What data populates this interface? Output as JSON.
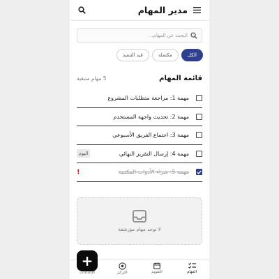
{
  "header": {
    "title": "مدير المهام",
    "menu_icon": "menu-icon",
    "search_icon": "search-icon"
  },
  "search": {
    "placeholder": "البحث عن المهام...",
    "value": ""
  },
  "filters": [
    {
      "label": "الكل",
      "active": true
    },
    {
      "label": "مكتملة",
      "active": false
    },
    {
      "label": "قيد التنفيذ",
      "active": false
    }
  ],
  "list": {
    "title": "قائمة المهام",
    "pending_count": "5 مهام متبقية"
  },
  "tasks": [
    {
      "label": "مهمة 1: مراجعة متطلبات المشروع",
      "checked": false,
      "badge": "",
      "alert": ""
    },
    {
      "label": "مهمة 2: تحديث واجهة المستخدم",
      "checked": false,
      "badge": "",
      "alert": ""
    },
    {
      "label": "مهمة 3: اجتماع الفريق الأسبوعي",
      "checked": false,
      "badge": "",
      "alert": ""
    },
    {
      "label": "مهمة 4: إرسال التقرير النهائي",
      "checked": false,
      "badge": "اليوم",
      "alert": ""
    },
    {
      "label": "مهمة 5: شراء الأدوات المكتبية",
      "checked": true,
      "badge": "",
      "alert": "!"
    }
  ],
  "archive": {
    "empty_text": "لا توجد مهام مؤرشفة",
    "icon": "inbox-icon"
  },
  "bottom_nav": [
    {
      "label": "المهام",
      "icon": "tasks-icon",
      "active": true
    },
    {
      "label": "التقويم",
      "icon": "calendar-icon",
      "active": false
    },
    {
      "label": "التركيز",
      "icon": "focus-icon",
      "active": false
    },
    {
      "label": "الإعدادات",
      "icon": "settings-icon",
      "active": false
    }
  ],
  "fab": {
    "label": "+",
    "icon": "plus-icon"
  },
  "colors": {
    "accent": "#2e3f8f",
    "alert": "#c62828",
    "fab": "#0b0b0b"
  }
}
